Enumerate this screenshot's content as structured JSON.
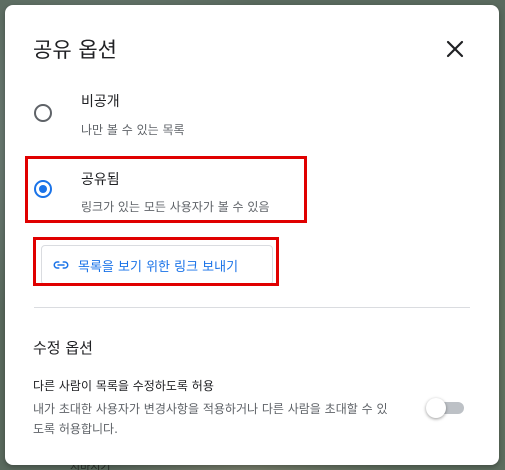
{
  "dialog": {
    "title": "공유 옵션",
    "close_icon": "close-icon"
  },
  "visibility": {
    "options": [
      {
        "label": "비공개",
        "description": "나만 볼 수 있는 목록",
        "selected": false
      },
      {
        "label": "공유됨",
        "description": "링크가 있는 모든 사용자가 볼 수 있음",
        "selected": true
      }
    ],
    "send_link": {
      "label": "목록을 보기 위한 링크 보내기",
      "icon": "link-icon"
    }
  },
  "edit_options": {
    "title": "수정 옵션",
    "allow_label": "다른 사람이 목록을 수정하도록 허용",
    "allow_description": "내가 초대한 사용자가 변경사항을 적용하거나 다른 사람을 초대할 수 있도록 허용합니다.",
    "enabled": false
  },
  "background": {
    "text": "지바지기"
  },
  "colors": {
    "accent": "#1a73e8",
    "highlight": "#e00000"
  }
}
